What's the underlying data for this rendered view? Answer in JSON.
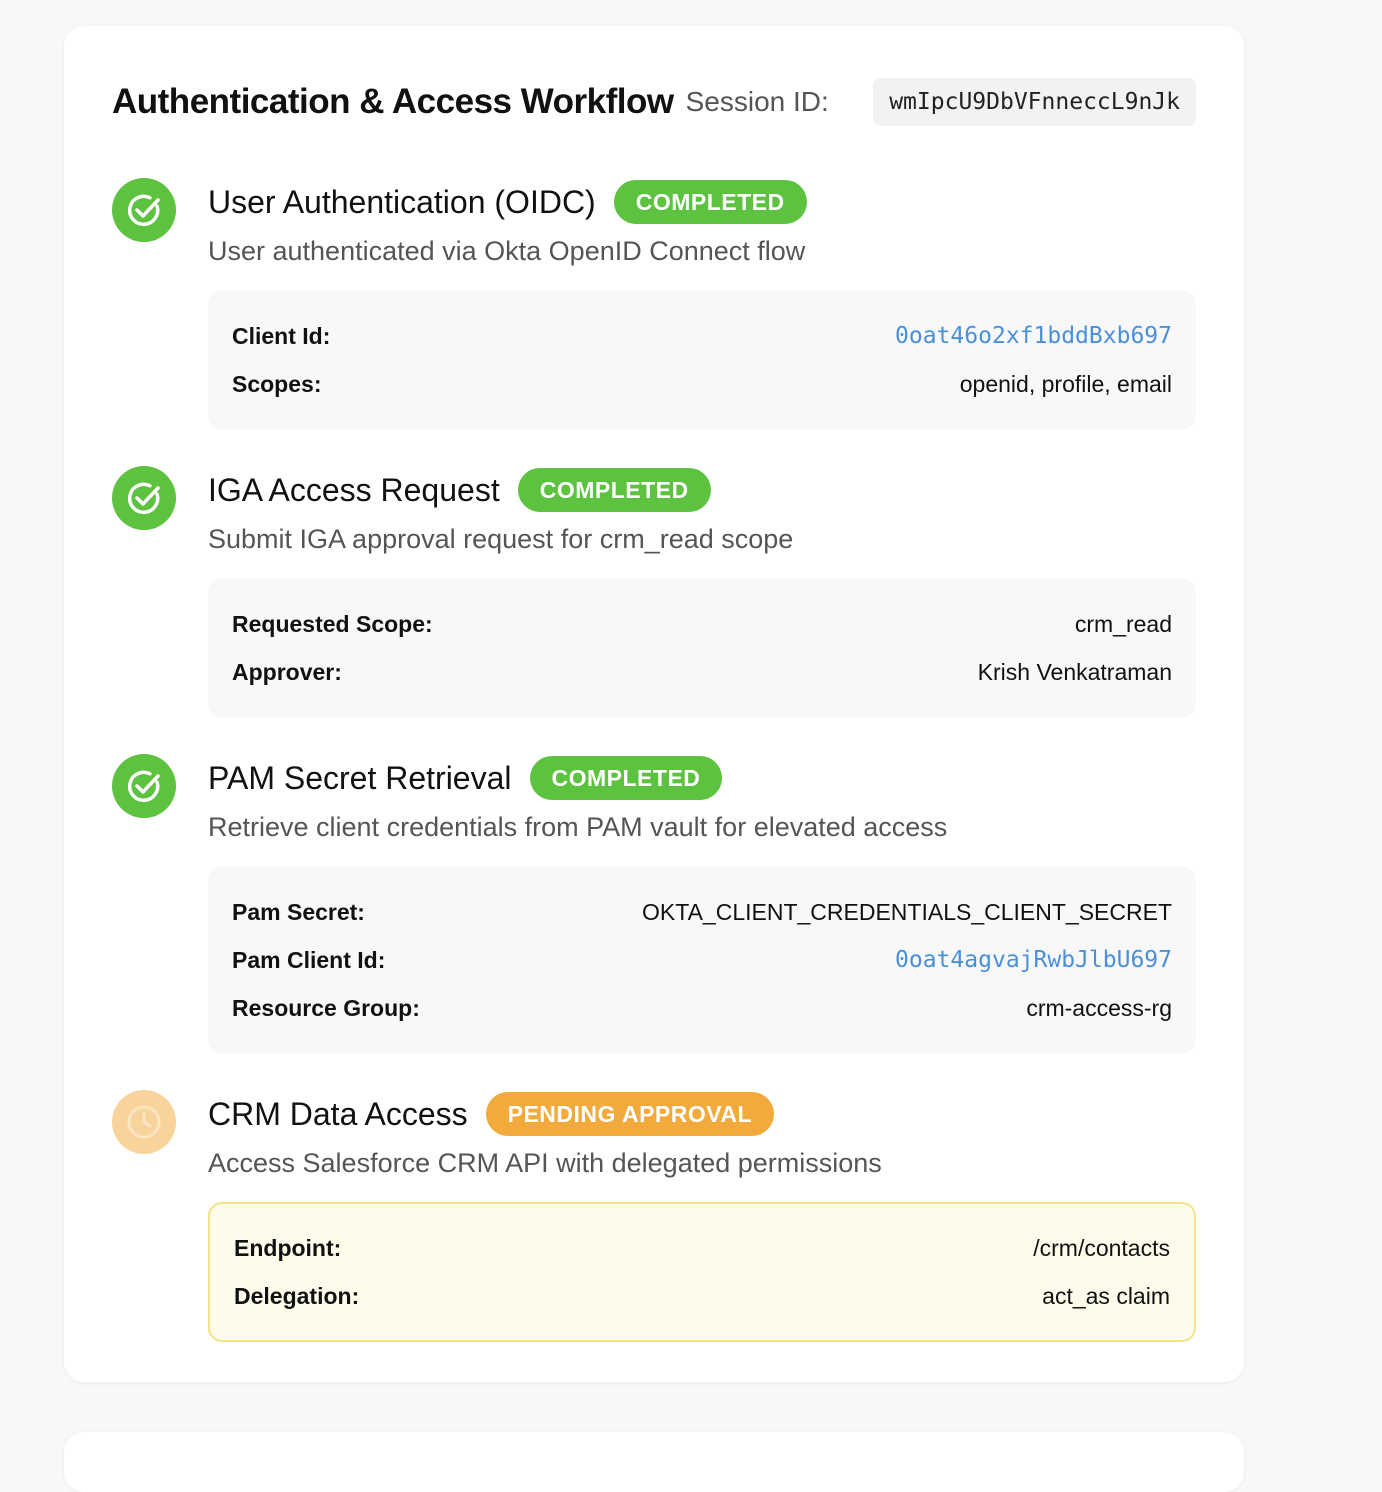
{
  "workflow": {
    "title": "Authentication & Access Workflow",
    "session_label": "Session ID:",
    "session_id": "wmIpcU9DbVFnneccL9nJk"
  },
  "colors": {
    "success": "#5cc240",
    "pending": "#f3aa3c",
    "link": "#4a90d9"
  },
  "steps": [
    {
      "title": "User Authentication (OIDC)",
      "status": "COMPLETED",
      "icon": "check-circle-icon",
      "description": "User authenticated via Okta OpenID Connect flow",
      "details": [
        {
          "key": "Client Id:",
          "value": "0oat46o2xf1bddBxb697"
        },
        {
          "key": "Scopes:",
          "value": "openid, profile, email"
        }
      ]
    },
    {
      "title": "IGA Access Request",
      "status": "COMPLETED",
      "icon": "check-circle-icon",
      "description": "Submit IGA approval request for crm_read scope",
      "details": [
        {
          "key": "Requested Scope:",
          "value": "crm_read"
        },
        {
          "key": "Approver:",
          "value": "Krish Venkatraman"
        }
      ]
    },
    {
      "title": "PAM Secret Retrieval",
      "status": "COMPLETED",
      "icon": "check-circle-icon",
      "description": "Retrieve client credentials from PAM vault for elevated access",
      "details": [
        {
          "key": "Pam Secret:",
          "value": "OKTA_CLIENT_CREDENTIALS_CLIENT_SECRET"
        },
        {
          "key": "Pam Client Id:",
          "value": "0oat4agvajRwbJlbU697"
        },
        {
          "key": "Resource Group:",
          "value": "crm-access-rg"
        }
      ]
    },
    {
      "title": "CRM Data Access",
      "status": "PENDING APPROVAL",
      "icon": "clock-icon",
      "description": "Access Salesforce CRM API with delegated permissions",
      "details": [
        {
          "key": "Endpoint:",
          "value": "/crm/contacts"
        },
        {
          "key": "Delegation:",
          "value": "act_as claim"
        }
      ]
    }
  ]
}
